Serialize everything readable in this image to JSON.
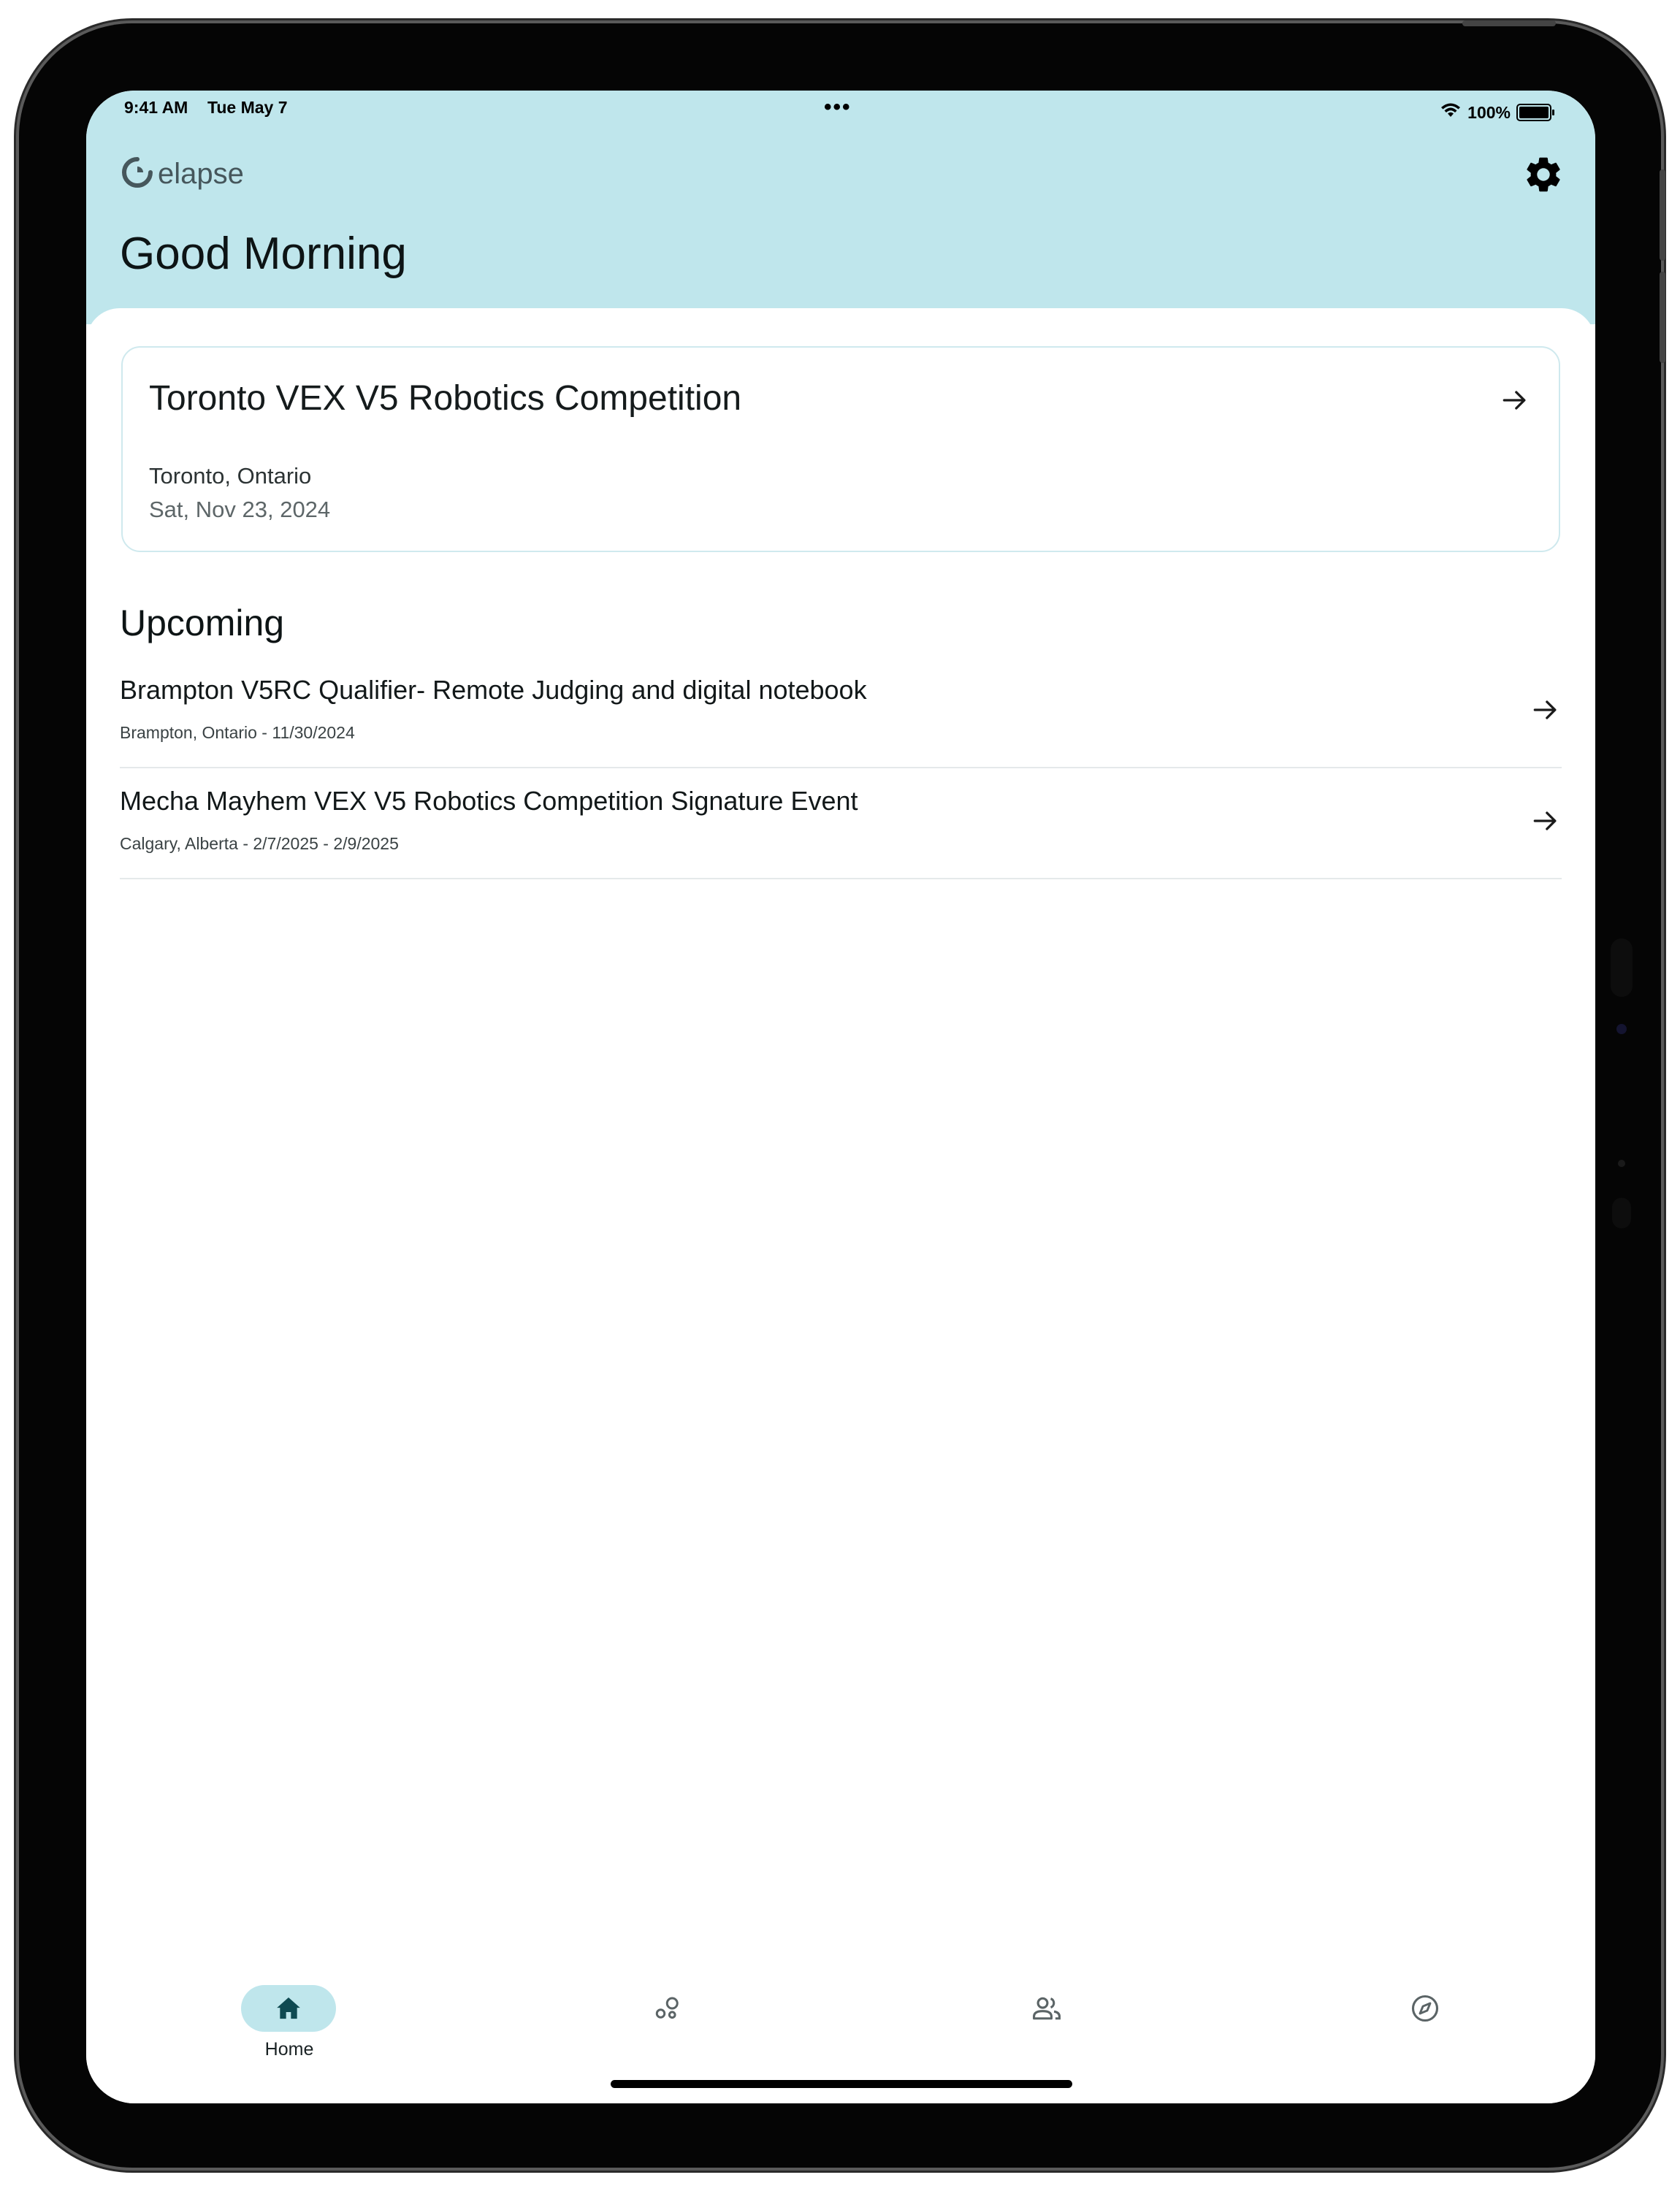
{
  "status_bar": {
    "time": "9:41 AM",
    "date": "Tue May 7",
    "dots": "•••",
    "battery": "100%"
  },
  "header": {
    "logo_text": "elapse",
    "greeting": "Good Morning",
    "background_color": "#bfe6ec"
  },
  "featured_event": {
    "title": "Toronto VEX V5 Robotics Competition",
    "location": "Toronto, Ontario",
    "date": "Sat, Nov 23, 2024"
  },
  "upcoming": {
    "section_title": "Upcoming",
    "items": [
      {
        "title": "Brampton V5RC Qualifier- Remote Judging and digital notebook",
        "meta": "Brampton, Ontario  -  11/30/2024"
      },
      {
        "title": "Mecha Mayhem VEX V5 Robotics Competition Signature Event",
        "meta": "Calgary, Alberta  -  2/7/2025 - 2/9/2025"
      }
    ]
  },
  "bottom_nav": {
    "items": [
      {
        "label": "Home",
        "icon": "home-icon",
        "active": true
      },
      {
        "label": "",
        "icon": "skills-icon",
        "active": false
      },
      {
        "label": "",
        "icon": "teams-icon",
        "active": false
      },
      {
        "label": "",
        "icon": "compass-icon",
        "active": false
      }
    ],
    "active_color": "#bfe6ec"
  }
}
